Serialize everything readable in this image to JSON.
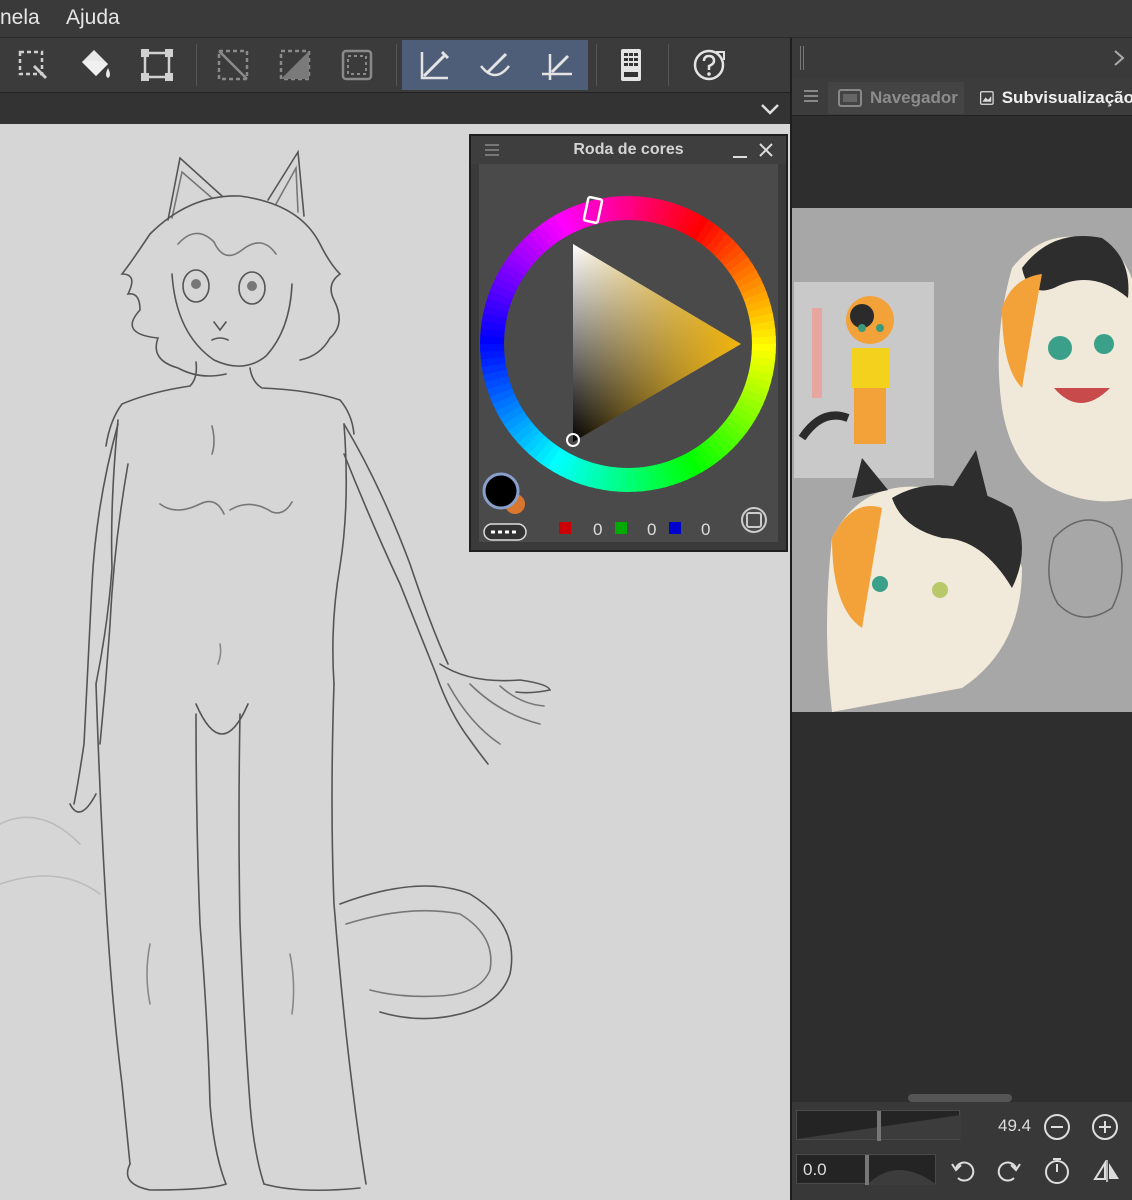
{
  "menubar": {
    "items": [
      {
        "label": "nela"
      },
      {
        "label": "Ajuda"
      }
    ]
  },
  "palette": {
    "title": "Roda de cores",
    "rgb": {
      "r": "0",
      "g": "0",
      "b": "0"
    },
    "hue_color": "#f2b40a",
    "main_color": "#000000",
    "sub_color": "#d9772e"
  },
  "right_panel": {
    "tabs": [
      {
        "label": "Navegador",
        "active": false
      },
      {
        "label": "Subvisualização",
        "active": true
      }
    ],
    "zoom_value": "49.4",
    "rotation_value": "0.0"
  },
  "icons": {
    "toolbar": [
      "select-all-icon",
      "fill-icon",
      "transform-icon",
      "deselect-icon",
      "invert-selection-icon",
      "selection-border-icon",
      "snap-ruler-icon",
      "snap-special-ruler-icon",
      "snap-grid-icon",
      "edit-pad-icon",
      "help-icon"
    ]
  }
}
